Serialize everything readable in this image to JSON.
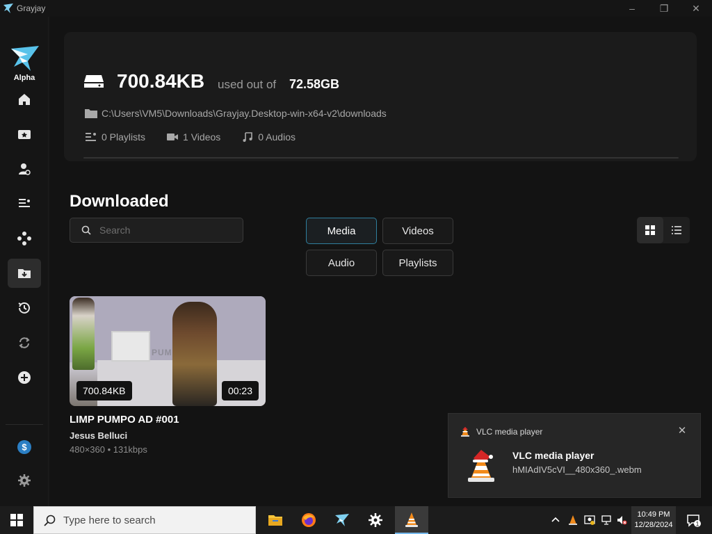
{
  "window": {
    "title": "Grayjay",
    "minimize": "–",
    "maximize": "❐",
    "close": "✕"
  },
  "sidebar": {
    "logo_label": "Alpha",
    "items": [
      {
        "icon": "home-icon"
      },
      {
        "icon": "subscriptions-icon"
      },
      {
        "icon": "creators-icon"
      },
      {
        "icon": "playlists-icon"
      },
      {
        "icon": "sources-icon"
      },
      {
        "icon": "downloads-icon"
      },
      {
        "icon": "history-icon"
      },
      {
        "icon": "sync-icon"
      },
      {
        "icon": "add-icon"
      }
    ],
    "bottom_items": [
      {
        "icon": "donate-icon",
        "label": "$"
      },
      {
        "icon": "settings-icon"
      }
    ]
  },
  "storage": {
    "used": "700.84KB",
    "used_label": "used out of",
    "total": "72.58GB",
    "path": "C:\\Users\\VM5\\Downloads\\Grayjay.Desktop-win-x64-v2\\downloads",
    "playlists": "0 Playlists",
    "videos": "1 Videos",
    "audios": "0 Audios",
    "used_fraction": 1e-05
  },
  "downloads": {
    "title": "Downloaded",
    "search_placeholder": "Search",
    "filters": [
      "Media",
      "Videos",
      "Audio",
      "Playlists"
    ],
    "active_filter": "Media",
    "view_modes": [
      "grid",
      "list"
    ],
    "active_view": "grid"
  },
  "items": [
    {
      "size": "700.84KB",
      "duration": "00:23",
      "thumb_sign": "PUMPO",
      "title": "LIMP PUMPO AD #001",
      "author": "Jesus Belluci",
      "meta": "480×360 • 131kbps"
    }
  ],
  "toast": {
    "app": "VLC media player",
    "title": "VLC media player",
    "body": "hMIAdIV5cVI__480x360_.webm",
    "close": "✕"
  },
  "taskbar": {
    "search_placeholder": "Type here to search",
    "apps": [
      "file-explorer-icon",
      "firefox-icon",
      "grayjay-icon",
      "settings-gear-icon",
      "vlc-icon"
    ],
    "time": "10:49 PM",
    "date": "12/28/2024",
    "notification_count": "1"
  },
  "colors": {
    "accent": "#2f7f9e",
    "background": "#131313",
    "card": "#1b1b1b"
  }
}
